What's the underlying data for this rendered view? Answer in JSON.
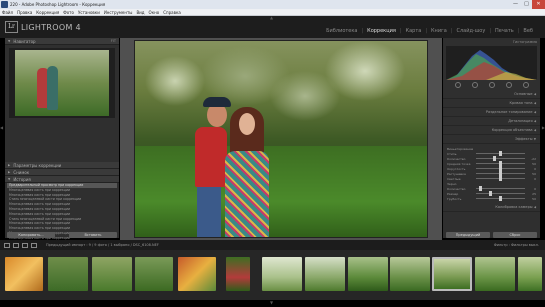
{
  "window": {
    "title": "220 - Adobe Photoshop Lightroom - Коррекция",
    "buttons": [
      "—",
      "□",
      "✕"
    ]
  },
  "menu": [
    "Файл",
    "Правка",
    "Коррекция",
    "Фото",
    "Установки",
    "Инструменты",
    "Вид",
    "Окно",
    "Справка"
  ],
  "identity": {
    "badge": "Lr",
    "brand": "LIGHTROOM 4"
  },
  "modules": [
    "Библиотека",
    "Коррекция",
    "Карта",
    "Книга",
    "Слайд-шоу",
    "Печать",
    "Веб"
  ],
  "active_module": "Коррекция",
  "left_panel": {
    "navigator": {
      "title": "Навигатор",
      "modes": "FIT"
    },
    "sections": [
      "Параметры коррекции",
      "Снимок",
      "История"
    ],
    "history": [
      "Предварительный просмотр при коррекции",
      "Многоцелевая кисть при коррекции",
      "Многоцелевая кисть при коррекции",
      "Стиль многоцелевой кисти при коррекции",
      "Многоцелевая кисть при коррекции",
      "Многоцелевая кисть при коррекции",
      "Многоцелевая кисть при коррекции",
      "Стиль многоцелевой кисти при коррекции",
      "Многоцелевая кисть при коррекции",
      "Многоцелевая кисть при коррекции",
      "Многоцелевая кисть при коррекции",
      "Многоцелевая кисть при коррекции",
      "Многоцелевая кисть при коррекции",
      "Многоцелевая кисть при коррекции",
      "Многоцелевая кисть при коррекции",
      "Многоцелевая кисть при коррекции",
      "Многоцелевая кисть при коррекции",
      "Многоцелевая кисть при коррекции"
    ],
    "selected_history_index": 0,
    "buttons": {
      "copy": "Копировать...",
      "paste": "Вставить"
    }
  },
  "right_panel": {
    "histogram_title": "Гистограмма",
    "sections": [
      "Основные",
      "Кривая тона",
      "Раздельное тонирование",
      "Детализация",
      "Коррекция объектива",
      "Эффекты"
    ],
    "effects_group": "Виньетирование после кадрирования",
    "sliders": [
      {
        "name": "Стиль",
        "value": "",
        "pos": 0.5
      },
      {
        "name": "Количество",
        "value": "-22",
        "pos": 0.38
      },
      {
        "name": "Средняя точка",
        "value": "50",
        "pos": 0.5
      },
      {
        "name": "Округлость",
        "value": "0",
        "pos": 0.5
      },
      {
        "name": "Растушевка",
        "value": "50",
        "pos": 0.5
      },
      {
        "name": "Светлые",
        "value": "0",
        "pos": 0.5
      }
    ],
    "grain_group": "Зерно",
    "grain_sliders": [
      {
        "name": "Количество",
        "value": "0",
        "pos": 0.1
      },
      {
        "name": "Размер",
        "value": "25",
        "pos": 0.3
      },
      {
        "name": "Грубость",
        "value": "50",
        "pos": 0.5
      }
    ],
    "calibration": "Калибровка камеры",
    "buttons": {
      "previous": "Предыдущий",
      "reset": "Сброс"
    }
  },
  "filmstrip": {
    "info": "Предыдущий импорт : 9 / 9 фото / 1 выбрано / DSC_6108.NEF",
    "filter_label": "Фильтр :",
    "filter_value": "Фильтры выкл.",
    "selected_index": 5
  },
  "colors": {
    "panel": "#2f2f2f",
    "accent_red": "#c02a2a",
    "grass_green": "#4b8a2a"
  }
}
